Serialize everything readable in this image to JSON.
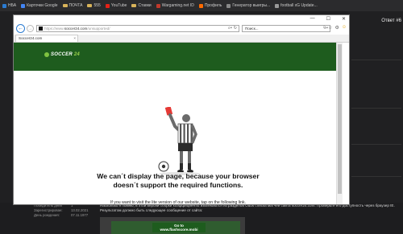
{
  "bookmarks": [
    {
      "label": "НБА",
      "icon": "bookmark-icon",
      "color": "#2a7bd1"
    },
    {
      "label": "Карточки Google",
      "icon": "google-icon",
      "color": "#4285f4"
    },
    {
      "label": "ПОЧТА",
      "icon": "folder-icon",
      "color": "#d8b35a"
    },
    {
      "label": "555",
      "icon": "folder-icon",
      "color": "#d8b35a"
    },
    {
      "label": "YouTube",
      "icon": "youtube-icon",
      "color": "#e62117"
    },
    {
      "label": "Ставки",
      "icon": "folder-icon",
      "color": "#d8b35a"
    },
    {
      "label": "Wargaming.net ID",
      "icon": "wargaming-icon",
      "color": "#c0392b"
    },
    {
      "label": "Профиль",
      "icon": "profile-icon",
      "color": "#ff6a00"
    },
    {
      "label": "Генератор выигры...",
      "icon": "generator-icon",
      "color": "#888888"
    },
    {
      "label": "football xG Update...",
      "icon": "football-icon",
      "color": "#999999"
    }
  ],
  "ie": {
    "address_prefix": "https://www.",
    "address_host": "soccer24.com",
    "address_path": "/unsupported/",
    "search_placeholder": "Поиск...",
    "tab_title": "Soccer24.com"
  },
  "site": {
    "logo_text": "SOCCER",
    "logo_num": "24",
    "brand_color": "#1e5c1e",
    "message_line1": "We can´t display the page, because your browser",
    "message_line2": "doesn´t support the required functions.",
    "lite_hint": "If you want to visit the lite version of our website, tap on the following link.",
    "lite_button": "Go to www.flashscore.mobi"
  },
  "forum": {
    "right_title": "Ответ #6",
    "profile": [
      {
        "key": "Победитель дней",
        "value": "1"
      },
      {
        "key": "Зарегистрирован:",
        "value": "13.02.2021"
      },
      {
        "key": "День рождения:",
        "value": "07.11.1977"
      }
    ],
    "post_line1": "Насколько я помню, в этой версии сборки коэффициенты извлекаются из разделов Odds списка матчей сайта soccer24.com. Проверьте его доступность через браузер IE.",
    "post_line2": "Результатом должно быть следующее сообщение от сайта:"
  }
}
